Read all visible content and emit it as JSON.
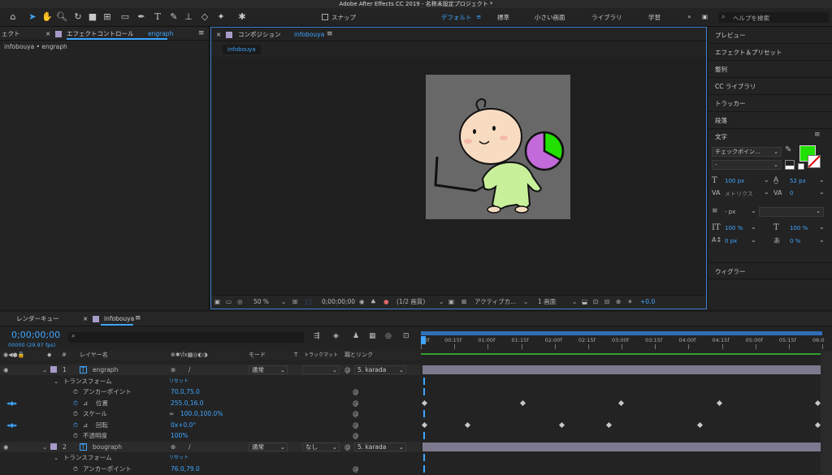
{
  "app": {
    "title": "Adobe After Effects CC 2019 - 名称未設定プロジェクト *"
  },
  "toolbar": {
    "snap_label": "スナップ",
    "workspaces": [
      "デフォルト",
      "標準",
      "小さい画面",
      "ライブラリ",
      "学習"
    ],
    "search_placeholder": "ヘルプを検索"
  },
  "effect_panel": {
    "left_tab": "ェクト",
    "tab_label": "エフェクトコントロール",
    "tab_layer": "engraph",
    "breadcrumb": "infobouya • engraph"
  },
  "comp_panel": {
    "tab_label": "コンポジション",
    "tab_name": "infobouya",
    "subtab": "infobouya",
    "zoom": "50 %",
    "timecode": "0;00;00;00",
    "resolution": "(1/2 画質)",
    "camera": "アクティブカ...",
    "views": "1 画面",
    "exposure": "+0.0"
  },
  "right_panel": {
    "items": [
      "プレビュー",
      "エフェクト＆プリセット",
      "整列",
      "CC ライブラリ",
      "トラッカー",
      "段落"
    ],
    "character_title": "文字",
    "font_name": "チェックボイン...",
    "font_style": "-",
    "font_size": "100 px",
    "leading": "52 px",
    "kerning": "メトリクス",
    "tracking": "0",
    "stroke_width": "- px",
    "vscale": "100 %",
    "hscale": "100 %",
    "baseline": "0 px",
    "tsume": "0 %",
    "wiggler": "ウィグラー",
    "fill_color": "#22e000"
  },
  "timeline": {
    "tabs": [
      "レンダーキュー",
      "infobouya"
    ],
    "timecode": "0;00;00;00",
    "fps": "00000 (29.97 fps)",
    "col_headers": {
      "num": "#",
      "layer_name": "レイヤー名",
      "mode": "モード",
      "t": "T",
      "trkmat": "トラックマット",
      "parent": "親とリンク"
    },
    "ruler": [
      "0f",
      "00:15f",
      "01:00f",
      "01:15f",
      "02:00f",
      "02:15f",
      "03:00f",
      "03:15f",
      "04:00f",
      "04:15f",
      "05:00f",
      "05:15f",
      "06:0"
    ],
    "rows": [
      {
        "type": "layer",
        "num": "1",
        "name": "engraph",
        "mode": "通常",
        "trkmat": "",
        "parent": "5. karada"
      },
      {
        "type": "group",
        "name": "トランスフォーム",
        "value": "リセット"
      },
      {
        "type": "prop",
        "name": "アンカーポイント",
        "value": "70.0,75.0"
      },
      {
        "type": "prop",
        "name": "位置",
        "value": "255.0,16.0"
      },
      {
        "type": "prop",
        "name": "スケール",
        "value": "100.0,100.0%"
      },
      {
        "type": "prop",
        "name": "回転",
        "value": "0x+0.0°"
      },
      {
        "type": "prop",
        "name": "不透明度",
        "value": "100%"
      },
      {
        "type": "layer",
        "num": "2",
        "name": "bougraph",
        "mode": "通常",
        "trkmat": "なし",
        "parent": "5. karada"
      },
      {
        "type": "group",
        "name": "トランスフォーム",
        "value": "リセット"
      },
      {
        "type": "prop",
        "name": "アンカーポイント",
        "value": "76.0,79.0"
      }
    ]
  },
  "colors": {
    "accent": "#3fa6ff",
    "label_purple": "#a89bc9",
    "bar_purple": "#7d7a8f",
    "green_fill": "#22e000"
  }
}
